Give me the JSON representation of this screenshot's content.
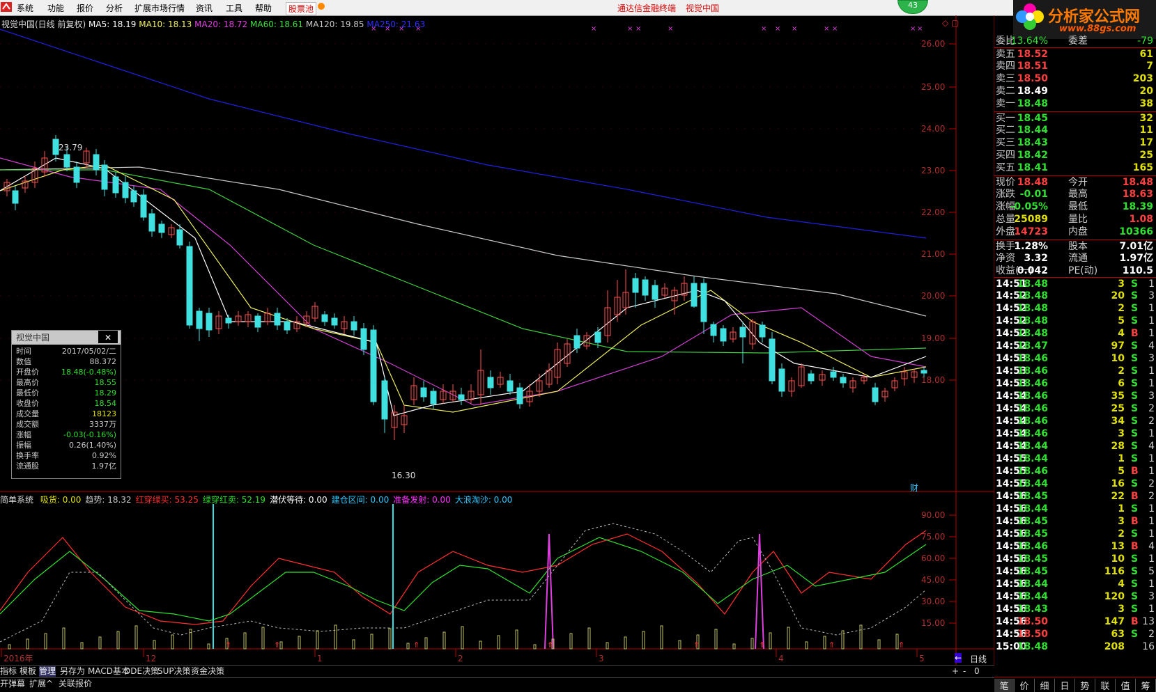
{
  "menubar": {
    "items": [
      "系统",
      "功能",
      "报价",
      "分析",
      "扩展市场行情",
      "资讯",
      "工具",
      "帮助",
      "股票池"
    ],
    "terminal_name": "通达信金融终端",
    "current_stock": "视觉中国",
    "online_count": "43",
    "brand": "分析家公式网",
    "brand_url": "www.88gs.com"
  },
  "main_legend": {
    "title": "视觉中国(日线 前复权)",
    "ma5": "MA5: 18.19",
    "ma10": "MA10: 18.13",
    "ma20": "MA20: 18.72",
    "ma60": "MA60: 18.61",
    "ma120": "MA120: 19.85",
    "ma250": "MA250: 21.63"
  },
  "price_axis": [
    "26.00",
    "25.00",
    "24.00",
    "23.00",
    "22.00",
    "21.00",
    "20.00",
    "19.00",
    "18.00"
  ],
  "annotations": {
    "high": "23.79",
    "low": "16.30",
    "fin_marker": "财"
  },
  "indicator_legend": {
    "name": "简单系统",
    "items": [
      {
        "label": "吸货: 0.00",
        "color": "#e0e000"
      },
      {
        "label": "趋势: 18.32",
        "color": "#c8c8c8"
      },
      {
        "label": "红穿绿买: 53.25",
        "color": "#ff3030"
      },
      {
        "label": "绿穿红卖: 52.19",
        "color": "#30e030"
      },
      {
        "label": "潜伏等待: 0.00",
        "color": "#ffffff"
      },
      {
        "label": "建仓区间: 0.00",
        "color": "#30c8ff"
      },
      {
        "label": "准备发射: 0.00",
        "color": "#ff30ff"
      },
      {
        "label": "大浪淘沙: 0.00",
        "color": "#30c8ff"
      }
    ]
  },
  "indicator_axis": [
    "90.00",
    "75.00",
    "60.00",
    "45.00",
    "30.00",
    "15.00"
  ],
  "time_axis": [
    "2016年",
    "12",
    "1",
    "2",
    "3",
    "4",
    "5"
  ],
  "period": "日线",
  "right_panel": {
    "weibi": {
      "label": "委比",
      "value": "-13.64%",
      "label2": "委差",
      "value2": "-79"
    },
    "asks": [
      {
        "label": "卖五",
        "price": "18.52",
        "vol": "61"
      },
      {
        "label": "卖四",
        "price": "18.51",
        "vol": "7"
      },
      {
        "label": "卖三",
        "price": "18.50",
        "vol": "203"
      },
      {
        "label": "卖二",
        "price": "18.49",
        "vol": "20"
      },
      {
        "label": "卖一",
        "price": "18.48",
        "vol": "38"
      }
    ],
    "bids": [
      {
        "label": "买一",
        "price": "18.45",
        "vol": "32"
      },
      {
        "label": "买二",
        "price": "18.44",
        "vol": "11"
      },
      {
        "label": "买三",
        "price": "18.43",
        "vol": "17"
      },
      {
        "label": "买四",
        "price": "18.42",
        "vol": "25"
      },
      {
        "label": "买五",
        "price": "18.41",
        "vol": "165"
      }
    ],
    "quote": [
      {
        "l1": "现价",
        "v1": "18.48",
        "c1": "#ff4040",
        "l2": "今开",
        "v2": "18.48",
        "c2": "#ff4040"
      },
      {
        "l1": "涨跌",
        "v1": "-0.01",
        "c1": "#30e030",
        "l2": "最高",
        "v2": "18.63",
        "c2": "#ff4040"
      },
      {
        "l1": "涨幅",
        "v1": "-0.05%",
        "c1": "#30e030",
        "l2": "最低",
        "v2": "18.39",
        "c2": "#30e030"
      },
      {
        "l1": "总量",
        "v1": "25089",
        "c1": "#e0e000",
        "l2": "量比",
        "v2": "1.08",
        "c2": "#ff4040"
      },
      {
        "l1": "外盘",
        "v1": "14723",
        "c1": "#ff4040",
        "l2": "内盘",
        "v2": "10366",
        "c2": "#30e030"
      }
    ],
    "fundamentals": [
      {
        "l1": "换手",
        "v1": "1.28%",
        "l2": "股本",
        "v2": "7.01亿"
      },
      {
        "l1": "净资",
        "v1": "3.32",
        "l2": "流通",
        "v2": "1.97亿"
      },
      {
        "l1": "收益(一)",
        "v1": "0.042",
        "l2": "PE(动)",
        "v2": "110.5"
      }
    ],
    "ticks": [
      {
        "t": "14:51",
        "p": "18.48",
        "v": "3",
        "d": "S",
        "n": "1"
      },
      {
        "t": "14:52",
        "p": "18.48",
        "v": "20",
        "d": "S",
        "n": "3"
      },
      {
        "t": "14:52",
        "p": "18.48",
        "v": "2",
        "d": "S",
        "n": "1"
      },
      {
        "t": "14:52",
        "p": "18.48",
        "v": "5",
        "d": "S",
        "n": "1"
      },
      {
        "t": "14:52",
        "p": "18.48",
        "v": "4",
        "d": "B",
        "n": "1"
      },
      {
        "t": "14:52",
        "p": "18.47",
        "v": "97",
        "d": "S",
        "n": "4"
      },
      {
        "t": "14:53",
        "p": "18.46",
        "v": "10",
        "d": "S",
        "n": "3"
      },
      {
        "t": "14:53",
        "p": "18.46",
        "v": "2",
        "d": "S",
        "n": "1"
      },
      {
        "t": "14:53",
        "p": "18.46",
        "v": "6",
        "d": "S",
        "n": "1"
      },
      {
        "t": "14:54",
        "p": "18.46",
        "v": "35",
        "d": "S",
        "n": "3"
      },
      {
        "t": "14:54",
        "p": "18.46",
        "v": "25",
        "d": "S",
        "n": "2"
      },
      {
        "t": "14:54",
        "p": "18.46",
        "v": "34",
        "d": "S",
        "n": "2"
      },
      {
        "t": "14:54",
        "p": "18.46",
        "v": "3",
        "d": "S",
        "n": "1"
      },
      {
        "t": "14:54",
        "p": "18.44",
        "v": "28",
        "d": "S",
        "n": "4"
      },
      {
        "t": "14:55",
        "p": "18.44",
        "v": "1",
        "d": "S",
        "n": "1"
      },
      {
        "t": "14:55",
        "p": "18.46",
        "v": "5",
        "d": "B",
        "n": "1"
      },
      {
        "t": "14:55",
        "p": "18.44",
        "v": "16",
        "d": "S",
        "n": "2"
      },
      {
        "t": "14:56",
        "p": "18.45",
        "v": "22",
        "d": "B",
        "n": "2"
      },
      {
        "t": "14:56",
        "p": "18.44",
        "v": "1",
        "d": "S",
        "n": "1"
      },
      {
        "t": "14:56",
        "p": "18.45",
        "v": "3",
        "d": "B",
        "n": "1"
      },
      {
        "t": "14:56",
        "p": "18.45",
        "v": "2",
        "d": "S",
        "n": "1"
      },
      {
        "t": "14:56",
        "p": "18.46",
        "v": "13",
        "d": "B",
        "n": "4"
      },
      {
        "t": "14:56",
        "p": "18.45",
        "v": "10",
        "d": "S",
        "n": "1"
      },
      {
        "t": "14:56",
        "p": "18.45",
        "v": "116",
        "d": "S",
        "n": "5"
      },
      {
        "t": "14:56",
        "p": "18.44",
        "v": "4",
        "d": "S",
        "n": "1"
      },
      {
        "t": "14:56",
        "p": "18.44",
        "v": "120",
        "d": "S",
        "n": "3"
      },
      {
        "t": "14:56",
        "p": "18.43",
        "v": "3",
        "d": "S",
        "n": "1"
      },
      {
        "t": "14:56",
        "p": "18.50",
        "v": "147",
        "d": "B",
        "n": "13"
      },
      {
        "t": "14:56",
        "p": "18.50",
        "v": "63",
        "d": "S",
        "n": "2"
      },
      {
        "t": "15:00",
        "p": "18.48",
        "v": "208",
        "d": "",
        "n": "16"
      }
    ],
    "tabs": [
      "笔",
      "价",
      "细",
      "日",
      "势",
      "联",
      "值",
      "筹"
    ]
  },
  "info_box": {
    "title": "视觉中国",
    "rows": [
      {
        "k": "时间",
        "v": "2017/05/02/二",
        "c": "#cccccc"
      },
      {
        "k": "数值",
        "v": "88.372",
        "c": "#cccccc"
      },
      {
        "k": "开盘价",
        "v": "18.48(-0.48%)",
        "c": "#30e030"
      },
      {
        "k": "最高价",
        "v": "18.55",
        "c": "#30e030"
      },
      {
        "k": "最低价",
        "v": "18.29",
        "c": "#30e030"
      },
      {
        "k": "收盘价",
        "v": "18.54",
        "c": "#30e030"
      },
      {
        "k": "成交量",
        "v": "18123",
        "c": "#e0e000"
      },
      {
        "k": "成交额",
        "v": "3337万",
        "c": "#cccccc"
      },
      {
        "k": "涨幅",
        "v": "-0.03(-0.16%)",
        "c": "#30e030"
      },
      {
        "k": "振幅",
        "v": "0.26(1.40%)",
        "c": "#cccccc"
      },
      {
        "k": "换手率",
        "v": "0.92%",
        "c": "#cccccc"
      },
      {
        "k": "流通股",
        "v": "1.97亿",
        "c": "#cccccc"
      }
    ]
  },
  "bottom_tabs_1": [
    "指标",
    "模板",
    "管理",
    "另存为",
    "MACD基本",
    "DDE决策",
    "SUP决策",
    "资金决策"
  ],
  "bottom_tabs_2": [
    "开弹幕",
    "扩展^",
    "关联报价"
  ],
  "bottom_controls": [
    "+",
    "-",
    "0"
  ]
}
